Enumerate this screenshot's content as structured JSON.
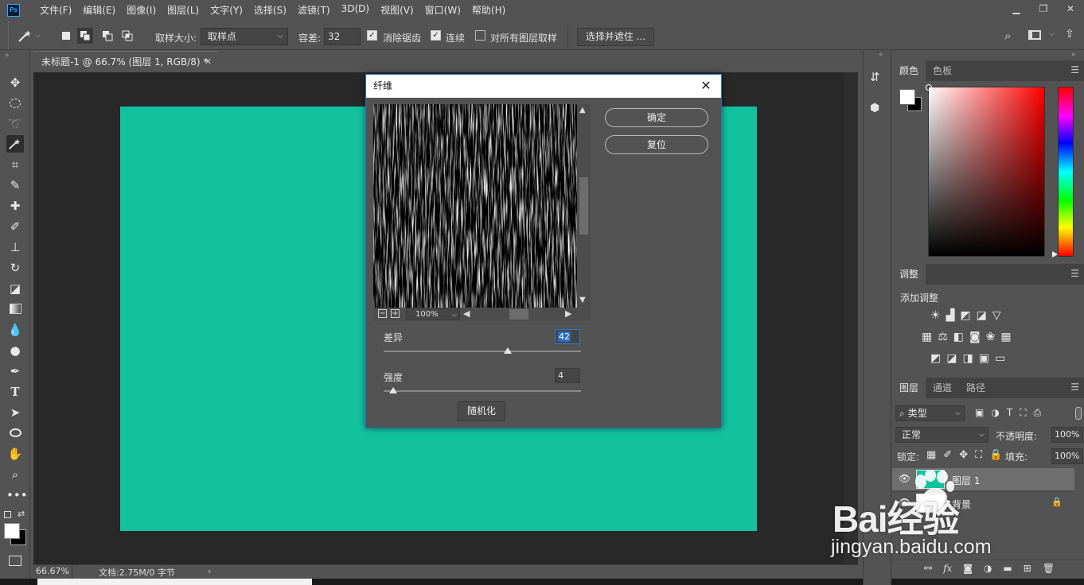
{
  "app": {
    "logo": "Ps",
    "menus": [
      "文件(F)",
      "编辑(E)",
      "图像(I)",
      "图层(L)",
      "文字(Y)",
      "选择(S)",
      "滤镜(T)",
      "3D(D)",
      "视图(V)",
      "窗口(W)",
      "帮助(H)"
    ]
  },
  "options": {
    "sample_size_label": "取样大小:",
    "sample_size_value": "取样点",
    "tolerance_label": "容差:",
    "tolerance_value": "32",
    "antialias_label": "消除锯齿",
    "contiguous_label": "连续",
    "all_layers_label": "对所有图层取样",
    "select_mask_button": "选择并遮住 ..."
  },
  "document": {
    "tab_title": "未标题-1 @ 66.7% (图层 1, RGB/8) *",
    "zoom": "66.67%",
    "doc_info": "文档:2.75M/0 字节",
    "canvas_color": "#12c29f"
  },
  "dialog": {
    "title": "纤维",
    "ok_label": "确定",
    "reset_label": "复位",
    "preview_zoom": "100%",
    "variance_label": "差异",
    "variance_value": "42",
    "variance_fraction": 0.63,
    "strength_label": "强度",
    "strength_value": "4",
    "strength_fraction": 0.05,
    "randomize_label": "随机化"
  },
  "color_panel": {
    "tabs": [
      "颜色",
      "色板"
    ]
  },
  "adjust_panel": {
    "tab": "调整",
    "add_label": "添加调整"
  },
  "layers_panel": {
    "tabs": [
      "图层",
      "通道",
      "路径"
    ],
    "filter_label": "类型",
    "blend_mode": "正常",
    "opacity_label": "不透明度:",
    "opacity_value": "100%",
    "lock_label": "锁定:",
    "fill_label": "填充:",
    "fill_value": "100%",
    "layers": [
      {
        "name": "图层 1"
      },
      {
        "name": "背景"
      }
    ]
  },
  "watermark": {
    "logo_text": "Bai经验",
    "url": "jingyan.baidu.com"
  }
}
